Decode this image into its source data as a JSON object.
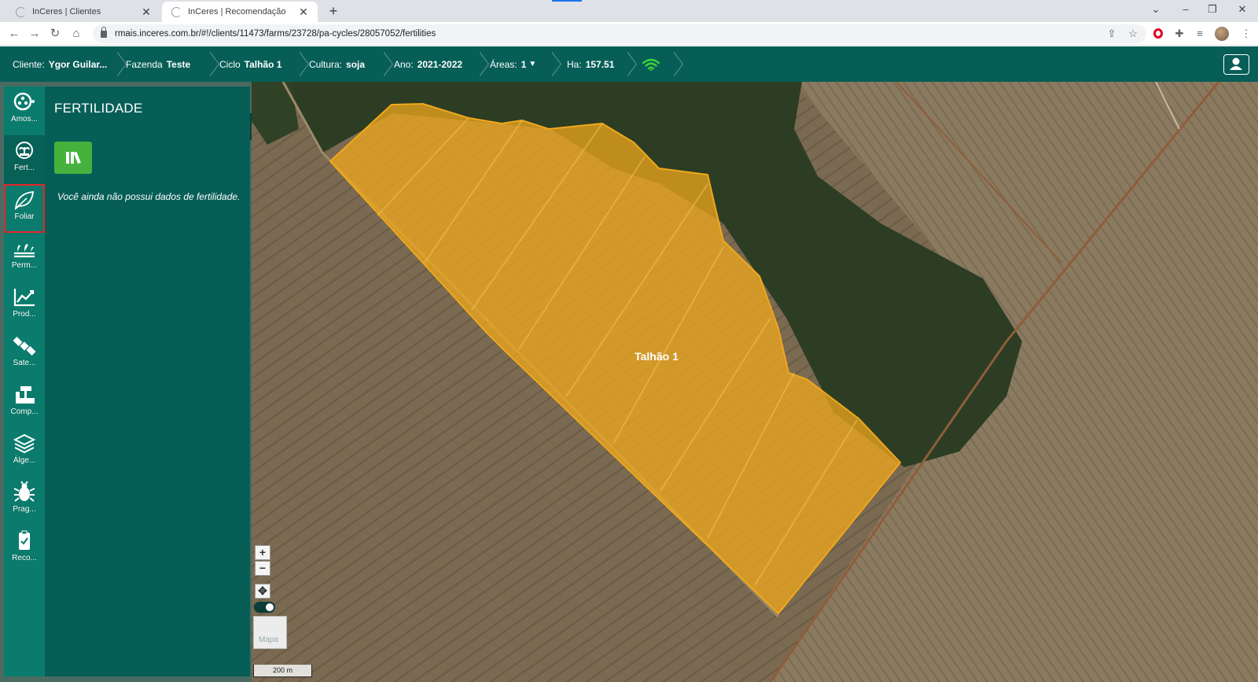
{
  "browser": {
    "tabs": [
      {
        "title": "InCeres | Clientes",
        "active": false
      },
      {
        "title": "InCeres | Recomendação",
        "active": true
      }
    ],
    "new_tab": "+",
    "url": "rmais.inceres.com.br/#!/clients/11473/farms/23728/pa-cycles/28057052/fertilities"
  },
  "header": {
    "breadcrumbs": [
      {
        "label": "Cliente:",
        "value": "Ygor Guilar..."
      },
      {
        "label": "Fazenda",
        "value": "Teste"
      },
      {
        "label": "Ciclo",
        "value": "Talhão 1"
      },
      {
        "label": "Cultura:",
        "value": "soja"
      },
      {
        "label": "Ano:",
        "value": "2021-2022"
      },
      {
        "label": "Áreas:",
        "value": "1"
      },
      {
        "label": "Ha:",
        "value": "157.51"
      }
    ],
    "wifi_color": "#3fd43a"
  },
  "sidebar": {
    "items": [
      {
        "label": "Amos...",
        "icon": "sampling-icon"
      },
      {
        "label": "Fert...",
        "icon": "fertility-icon"
      },
      {
        "label": "Foliar",
        "icon": "leaf-icon"
      },
      {
        "label": "Perm...",
        "icon": "perennial-icon"
      },
      {
        "label": "Prod...",
        "icon": "productivity-chart-icon"
      },
      {
        "label": "Sate...",
        "icon": "satellite-icon"
      },
      {
        "label": "Comp...",
        "icon": "compaction-icon"
      },
      {
        "label": "Álge...",
        "icon": "layers-icon"
      },
      {
        "label": "Prag...",
        "icon": "pest-icon"
      },
      {
        "label": "Reco...",
        "icon": "recommendation-icon"
      }
    ]
  },
  "panel": {
    "title": "FERTILIDADE",
    "empty_message": "Você ainda não possui dados de fertilidade.",
    "accent": "#45b23d"
  },
  "map": {
    "field_label": "Talhão 1",
    "field_color": "#f0a81c",
    "zoom_in": "+",
    "zoom_out": "−",
    "thumbnail_label": "Mapa",
    "scale_label": "200 m"
  }
}
